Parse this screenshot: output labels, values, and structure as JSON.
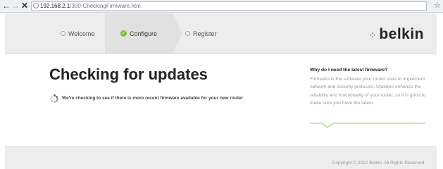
{
  "browser": {
    "url_host": "192.168.2.1",
    "url_path": "/300-CheckingFirmware.htm",
    "back_icon": "←",
    "forward_icon": "→",
    "stop_icon": "✕",
    "star_icon": "☆"
  },
  "steps": {
    "welcome": "Welcome",
    "configure": "Configure",
    "register": "Register",
    "check_icon": "✓"
  },
  "logo": {
    "mark": "·:·",
    "text": "belkin"
  },
  "main": {
    "title": "Checking for updates",
    "checking_text": "We're checking to see if there is more recent firmware available for your new router"
  },
  "sidebar": {
    "heading": "Why do I need the latest firmware?",
    "body": "Firmware is the software your router uses to implement network and security protocols. Updates enhance the reliability and functionality of your router, so it is good to make sure you have the latest."
  },
  "footer": {
    "copyright": "Copyright © 2012  Belkin, All Rights Reserved."
  },
  "colors": {
    "accent_green": "#7bbf3c",
    "bar_gray": "#ededed"
  }
}
